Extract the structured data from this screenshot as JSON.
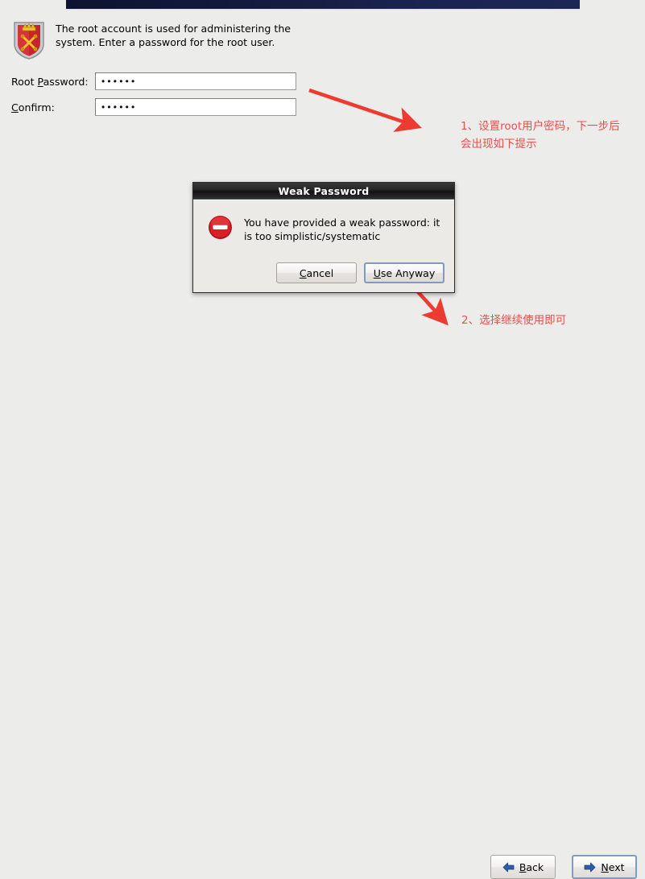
{
  "window": {
    "banner_color": "#131a3e",
    "background_color": "#ececeb"
  },
  "intro": {
    "icon": "shield-crest-icon",
    "text": "The root account is used for administering the system.  Enter a password for the root user."
  },
  "form": {
    "fields": [
      {
        "name": "root-password",
        "label_pre": "Root ",
        "label_accel": "P",
        "label_post": "assword:",
        "value": "••••••"
      },
      {
        "name": "confirm-password",
        "label_pre": "",
        "label_accel": "C",
        "label_post": "onfirm:",
        "value": "••••••"
      }
    ]
  },
  "dialog": {
    "title": "Weak Password",
    "icon": "stop-error-icon",
    "message": "You have provided a weak password: it is too simplistic/systematic",
    "buttons": [
      {
        "name": "cancel",
        "pre": "",
        "accel": "C",
        "post": "ancel",
        "default": false
      },
      {
        "name": "use-anyway",
        "pre": "",
        "accel": "U",
        "post": "se Anyway",
        "default": true
      }
    ]
  },
  "annotations": [
    {
      "name": "annotation-step-1",
      "number": "1",
      "text": "1、设置root用户密码，下一步后\n会出现如下提示",
      "color": "#e8504b"
    },
    {
      "name": "annotation-step-2",
      "number": "2",
      "text": "2、选择继续使用即可",
      "color": "#e8504b"
    }
  ],
  "nav": {
    "back": {
      "pre": "",
      "accel": "B",
      "post": "ack",
      "icon": "arrow-left-icon"
    },
    "next": {
      "pre": "",
      "accel": "N",
      "post": "ext",
      "icon": "arrow-right-icon"
    }
  }
}
